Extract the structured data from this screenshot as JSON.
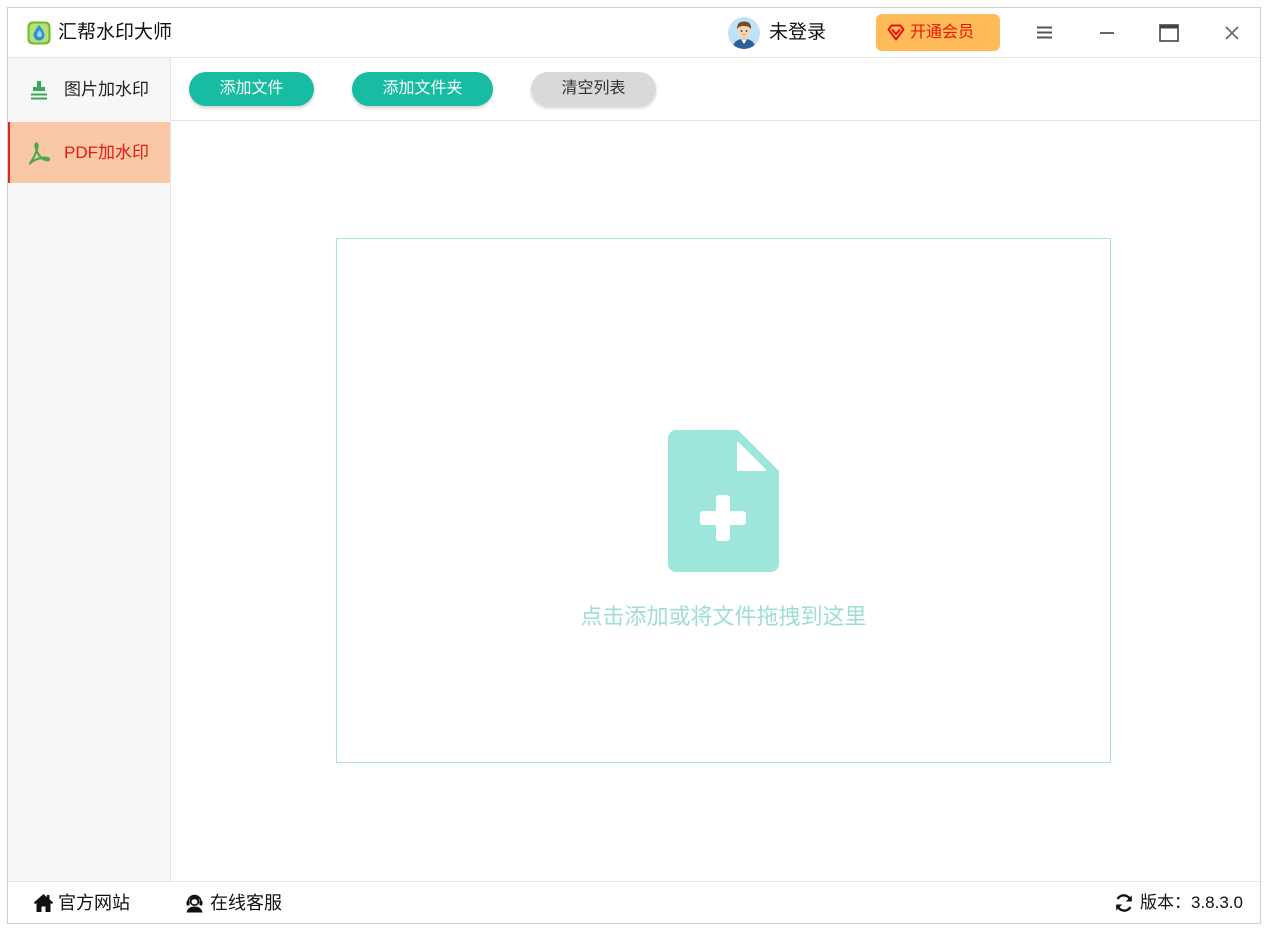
{
  "window": {
    "title": "汇帮水印大师",
    "logo_icon": "app-logo-icon",
    "controls": {
      "menu_icon": "menu-icon",
      "minimize_icon": "minimize-icon",
      "maximize_icon": "maximize-icon",
      "close_icon": "close-icon"
    }
  },
  "account": {
    "avatar_icon": "avatar-icon",
    "status": "未登录"
  },
  "vip": {
    "icon": "diamond-icon",
    "label": "开通会员"
  },
  "sidebar": {
    "items": [
      {
        "label": "图片加水印",
        "icon": "stamp-icon",
        "active": false
      },
      {
        "label": "PDF加水印",
        "icon": "pdf-icon",
        "active": true
      }
    ]
  },
  "toolbar": {
    "add_file": "添加文件",
    "add_folder": "添加文件夹",
    "clear_list": "清空列表"
  },
  "dropzone": {
    "icon": "file-add-icon",
    "hint": "点击添加或将文件拖拽到这里"
  },
  "footer": {
    "website": {
      "icon": "home-icon",
      "label": "官方网站"
    },
    "support": {
      "icon": "customer-service-icon",
      "label": "在线客服"
    },
    "version": {
      "icon": "refresh-icon",
      "label": "版本：3.8.3.0"
    }
  },
  "colors": {
    "accent": "#17bca2",
    "accent_border": "#a9e2db",
    "accent_light": "#9ee6dc",
    "hint_text": "#9fded6",
    "vip_bg": "#ffbb58",
    "vip_text": "#e8140c",
    "active_item_bg": "#f8c8a7",
    "active_text": "#e8190f",
    "active_bar": "#e3261b"
  }
}
